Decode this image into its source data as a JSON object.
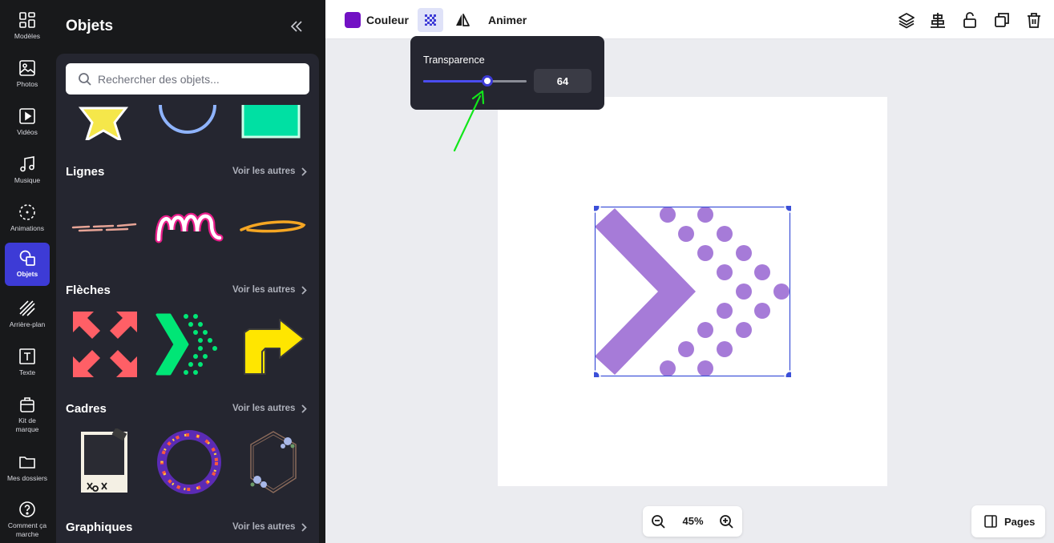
{
  "rail": {
    "items": [
      {
        "label": "Modèles",
        "icon": "templates-icon"
      },
      {
        "label": "Photos",
        "icon": "photo-icon"
      },
      {
        "label": "Vidéos",
        "icon": "video-icon"
      },
      {
        "label": "Musique",
        "icon": "music-icon"
      },
      {
        "label": "Animations",
        "icon": "animation-icon"
      },
      {
        "label": "Objets",
        "icon": "objects-icon",
        "active": true
      },
      {
        "label": "Arrière-plan",
        "icon": "background-icon"
      },
      {
        "label": "Texte",
        "icon": "text-icon"
      },
      {
        "label": "Kit de marque",
        "icon": "brand-kit-icon"
      },
      {
        "label": "Mes dossiers",
        "icon": "folder-icon"
      },
      {
        "label": "Comment ça marche",
        "icon": "help-icon"
      }
    ],
    "active_color": "#3d3bd6"
  },
  "panel": {
    "title": "Objets",
    "search_placeholder": "Rechercher des objets...",
    "see_more_label": "Voir les autres",
    "sections": [
      {
        "title": "Lignes"
      },
      {
        "title": "Flèches"
      },
      {
        "title": "Cadres"
      },
      {
        "title": "Graphiques"
      }
    ]
  },
  "toolbar": {
    "color_label": "Couleur",
    "color_value": "#7211c4",
    "animate_label": "Animer",
    "right_icons": [
      "layers-icon",
      "align-icon",
      "unlock-icon",
      "duplicate-icon",
      "trash-icon"
    ]
  },
  "transparency": {
    "label": "Transparence",
    "value": "64",
    "slider_fraction": 0.62
  },
  "canvas": {
    "design_color": "#a67bd8",
    "selection_color": "#3b4fd8"
  },
  "zoom": {
    "level": "45%"
  },
  "pages": {
    "label": "Pages"
  }
}
